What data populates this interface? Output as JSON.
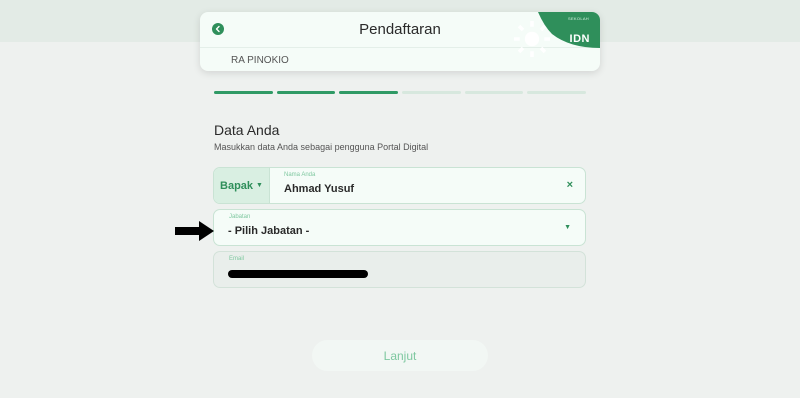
{
  "header": {
    "title": "Pendaftaran",
    "school_name": "RA PINOKIO",
    "brand": {
      "name": "IDN",
      "sub": "SEKOLAH"
    },
    "back_icon": "chevron-left-icon"
  },
  "progress": {
    "total_steps": 6,
    "completed_steps": 3,
    "accent": "#2f9a65"
  },
  "form": {
    "section_title": "Data Anda",
    "section_subtitle": "Masukkan data Anda sebagai pengguna Portal Digital",
    "title_select": "Bapak",
    "name_label": "Nama Anda",
    "name_value": "Ahmad Yusuf",
    "clear_symbol": "×",
    "jabatan_label": "Jabatan",
    "jabatan_value": "- Pilih Jabatan -",
    "email_label": "Email"
  },
  "submit_label": "Lanjut",
  "colors": {
    "brand_green": "#2f8f5b",
    "background": "#eef1ef",
    "field_bg": "#f5fcf8"
  }
}
